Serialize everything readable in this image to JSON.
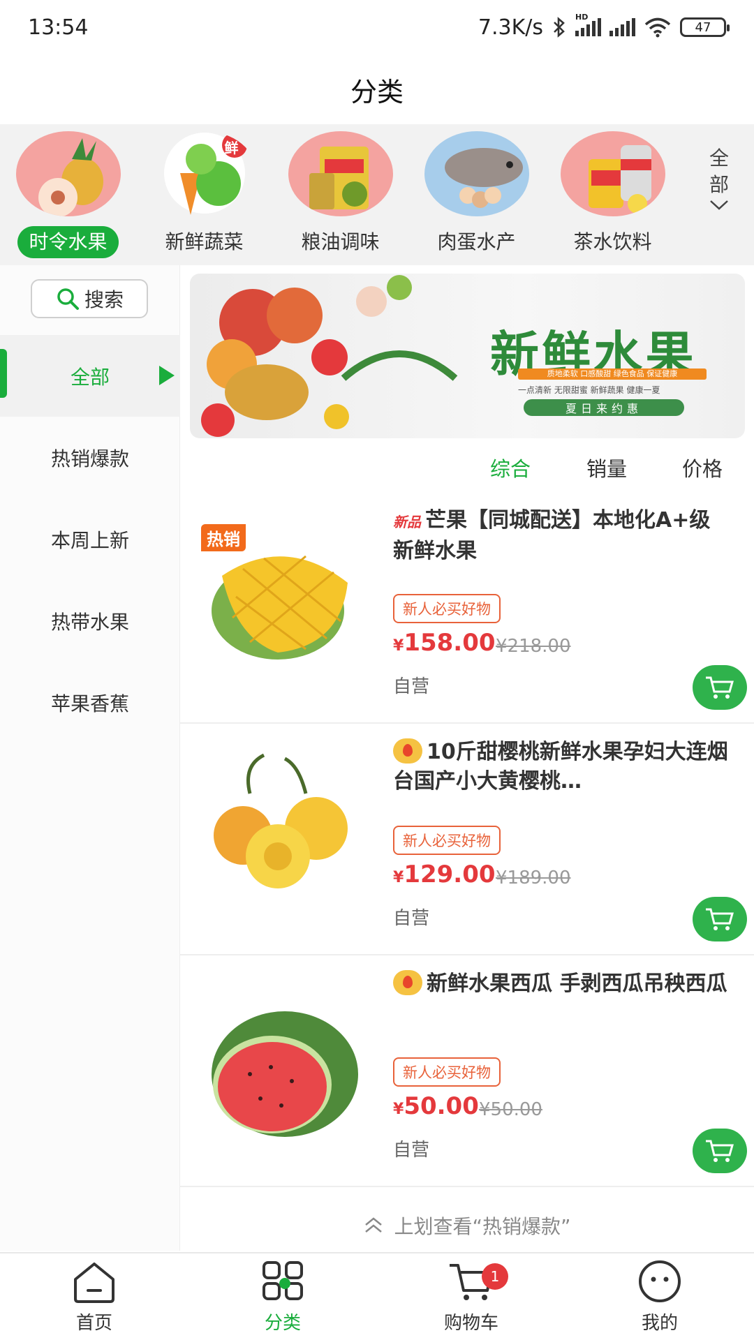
{
  "status_bar": {
    "time": "13:54",
    "network_speed": "7.3K/s",
    "hd_label": "HD",
    "battery": "47"
  },
  "header": {
    "title": "分类"
  },
  "categories": [
    {
      "label": "时令水果",
      "active": true
    },
    {
      "label": "新鲜蔬菜",
      "active": false,
      "stamp": "鲜"
    },
    {
      "label": "粮油调味",
      "active": false
    },
    {
      "label": "肉蛋水产",
      "active": false
    },
    {
      "label": "茶水饮料",
      "active": false
    }
  ],
  "category_all": {
    "line1": "全",
    "line2": "部"
  },
  "sidebar": {
    "search_label": "搜索",
    "items": [
      {
        "label": "全部",
        "active": true
      },
      {
        "label": "热销爆款",
        "active": false
      },
      {
        "label": "本周上新",
        "active": false
      },
      {
        "label": "热带水果",
        "active": false
      },
      {
        "label": "苹果香蕉",
        "active": false
      }
    ]
  },
  "banner": {
    "title": "新鲜水果",
    "features": "质地柔软 口感酸甜 绿色食品 保证健康",
    "tags": "一点清新 无限甜蜜 新鲜蔬果 健康一夏",
    "subtitle": "夏日来约惠"
  },
  "sort_tabs": [
    {
      "label": "综合",
      "active": true
    },
    {
      "label": "销量",
      "active": false
    },
    {
      "label": "价格",
      "active": false
    }
  ],
  "products": [
    {
      "badge": "热销",
      "title_tag": "新品",
      "title": "芒果【同城配送】本地化A+级新鲜水果",
      "promo_tag": "新人必买好物",
      "currency": "¥",
      "price": "158.00",
      "original_price": "¥218.00",
      "shop": "自营"
    },
    {
      "title": "10斤甜樱桃新鲜水果孕妇大连烟台国产小大黄樱桃…",
      "promo_tag": "新人必买好物",
      "currency": "¥",
      "price": "129.00",
      "original_price": "¥189.00",
      "shop": "自营"
    },
    {
      "title": "新鲜水果西瓜 手剥西瓜吊秧西瓜",
      "promo_tag": "新人必买好物",
      "currency": "¥",
      "price": "50.00",
      "original_price": "¥50.00",
      "shop": "自营"
    }
  ],
  "more_hint": "上划查看“热销爆款”",
  "bottom_nav": [
    {
      "label": "首页",
      "icon": "home-icon",
      "active": false
    },
    {
      "label": "分类",
      "icon": "category-icon",
      "active": true
    },
    {
      "label": "购物车",
      "icon": "cart-icon",
      "active": false,
      "badge": "1"
    },
    {
      "label": "我的",
      "icon": "profile-icon",
      "active": false
    }
  ],
  "colors": {
    "accent": "#1aad3c",
    "price": "#e4393c",
    "promo": "#e8623a"
  }
}
